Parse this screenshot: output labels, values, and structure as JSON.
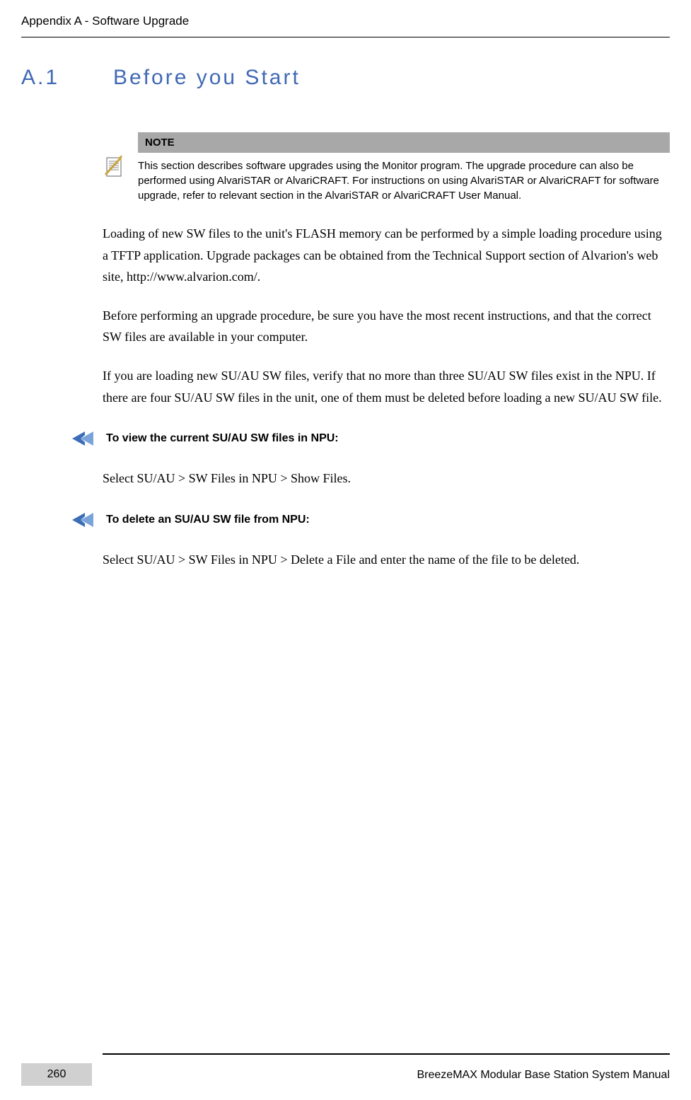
{
  "header": {
    "title": "Appendix A - Software Upgrade"
  },
  "section": {
    "number": "A.1",
    "title": "Before you Start"
  },
  "note": {
    "label": "NOTE",
    "body": "This section describes software upgrades using the Monitor program. The upgrade procedure can also be performed using AlvariSTAR or AlvariCRAFT. For instructions on using AlvariSTAR or AlvariCRAFT for software upgrade, refer to relevant section in the AlvariSTAR or AlvariCRAFT User Manual."
  },
  "paragraphs": {
    "p1": "Loading of new SW files to the unit's FLASH memory can be performed by a simple loading procedure using a TFTP application. Upgrade packages can be obtained from the Technical Support section of Alvarion's web site, http://www.alvarion.com/.",
    "p2": "Before performing an upgrade procedure, be sure you have the most recent instructions, and that the correct SW files are available in your computer.",
    "p3": "If you are loading new SU/AU SW files, verify that no more than three SU/AU SW files exist in the NPU. If there are four SU/AU SW files in the unit, one of them must be deleted before loading a new SU/AU SW file."
  },
  "procedures": {
    "proc1_title": "To view the current SU/AU SW files in NPU:",
    "proc1_body": "Select SU/AU > SW Files in NPU > Show Files.",
    "proc2_title": "To delete an SU/AU SW file from NPU:",
    "proc2_body": "Select SU/AU > SW Files in NPU > Delete a File and enter the name of the file to be deleted."
  },
  "footer": {
    "page_number": "260",
    "manual_title": "BreezeMAX Modular Base Station System Manual"
  }
}
